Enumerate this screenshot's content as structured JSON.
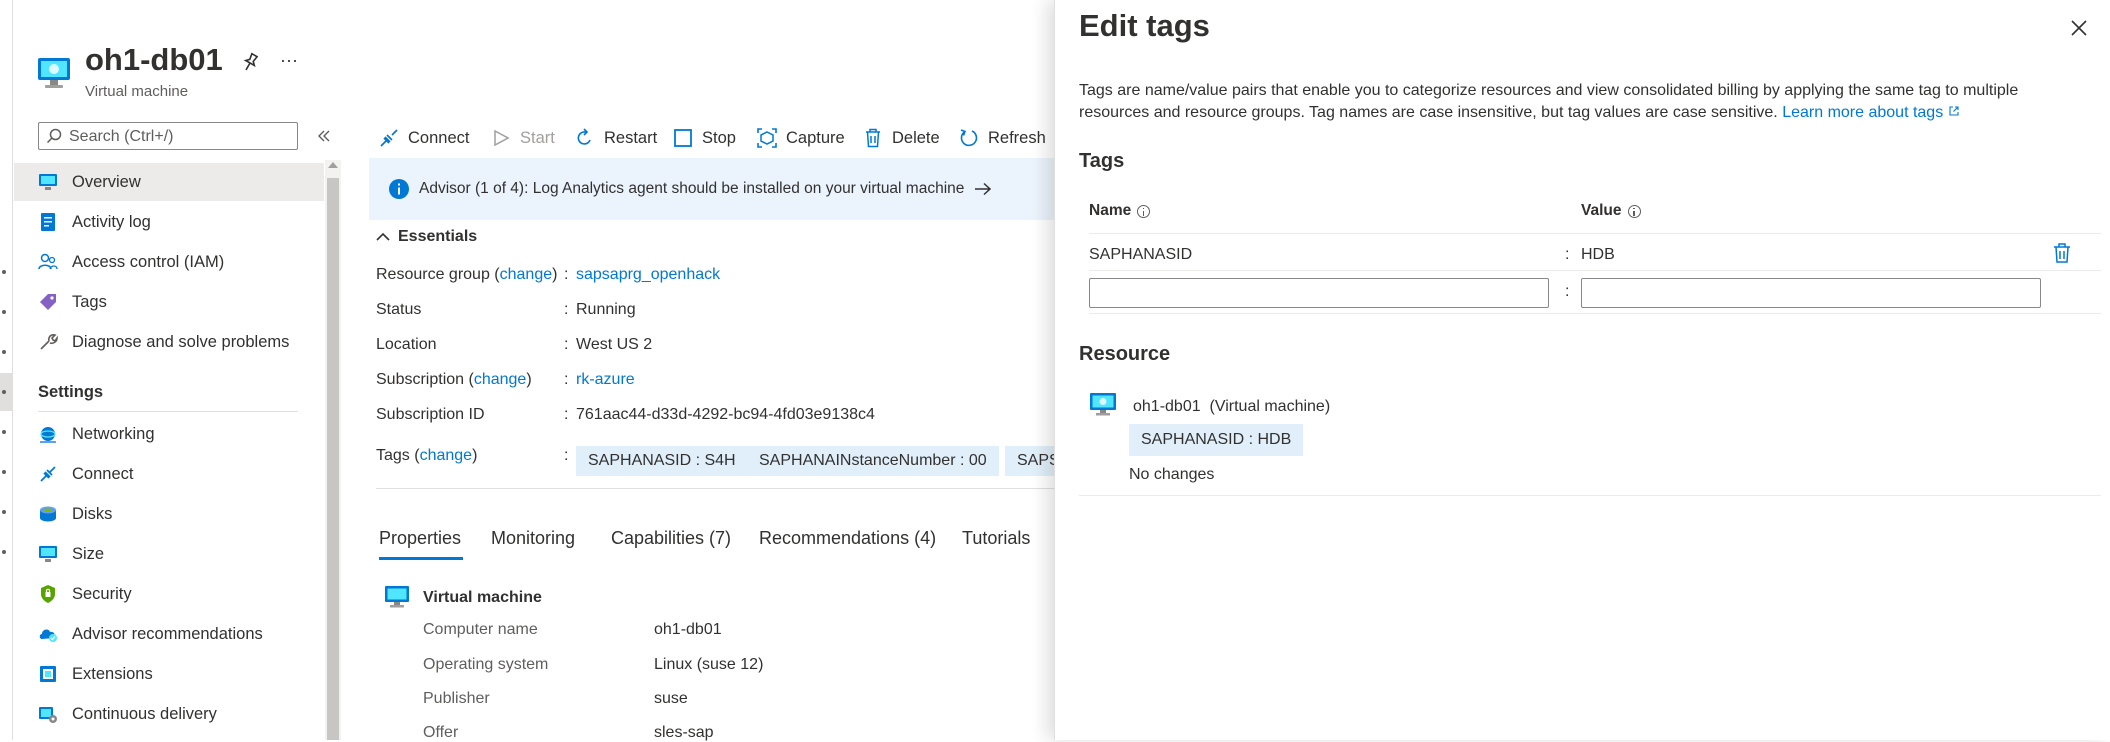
{
  "header": {
    "title": "oh1-db01",
    "subtitle": "Virtual machine",
    "more_label": "···"
  },
  "search": {
    "placeholder": "Search (Ctrl+/)"
  },
  "sidebar": {
    "items": [
      {
        "label": "Overview",
        "icon": "monitor-icon"
      },
      {
        "label": "Activity log",
        "icon": "activity-log-icon"
      },
      {
        "label": "Access control (IAM)",
        "icon": "people-icon"
      },
      {
        "label": "Tags",
        "icon": "tag-icon"
      },
      {
        "label": "Diagnose and solve problems",
        "icon": "wrench-icon"
      }
    ],
    "settings_label": "Settings",
    "settings_items": [
      {
        "label": "Networking",
        "icon": "networking-icon"
      },
      {
        "label": "Connect",
        "icon": "connect-icon"
      },
      {
        "label": "Disks",
        "icon": "disks-icon"
      },
      {
        "label": "Size",
        "icon": "size-icon"
      },
      {
        "label": "Security",
        "icon": "shield-icon"
      },
      {
        "label": "Advisor recommendations",
        "icon": "advisor-icon"
      },
      {
        "label": "Extensions",
        "icon": "extensions-icon"
      },
      {
        "label": "Continuous delivery",
        "icon": "delivery-icon"
      }
    ]
  },
  "toolbar": {
    "connect": "Connect",
    "start": "Start",
    "restart": "Restart",
    "stop": "Stop",
    "capture": "Capture",
    "delete": "Delete",
    "refresh": "Refresh"
  },
  "advisor": {
    "message": "Advisor (1 of 4): Log Analytics agent should be installed on your virtual machine"
  },
  "essentials": {
    "heading": "Essentials",
    "resource_group_label": "Resource group",
    "change": "change",
    "resource_group_value": "sapsaprg_openhack",
    "status_label": "Status",
    "status_value": "Running",
    "location_label": "Location",
    "location_value": "West US 2",
    "subscription_label": "Subscription",
    "subscription_value": "rk-azure",
    "subscription_id_label": "Subscription ID",
    "subscription_id_value": "761aac44-d33d-4292-bc94-4fd03e9138c4",
    "tags_label": "Tags",
    "tags": [
      "SAPHANASID : S4H",
      "SAPHANAINstanceNumber : 00",
      "SAPS"
    ]
  },
  "tabs": [
    "Properties",
    "Monitoring",
    "Capabilities (7)",
    "Recommendations (4)",
    "Tutorials"
  ],
  "properties": {
    "section_title": "Virtual machine",
    "rows": [
      {
        "key": "Computer name",
        "value": "oh1-db01"
      },
      {
        "key": "Operating system",
        "value": "Linux (suse 12)"
      },
      {
        "key": "Publisher",
        "value": "suse"
      },
      {
        "key": "Offer",
        "value": "sles-sap"
      }
    ]
  },
  "panel": {
    "title": "Edit tags",
    "description": "Tags are name/value pairs that enable you to categorize resources and view consolidated billing by applying the same tag to multiple resources and resource groups. Tag names are case insensitive, but tag values are case sensitive.",
    "learn_more": "Learn more about tags",
    "tags_heading": "Tags",
    "name_col": "Name",
    "value_col": "Value",
    "tag_rows": [
      {
        "name": "SAPHANASID",
        "value": "HDB"
      }
    ],
    "new_name_value": "",
    "new_value_value": "",
    "resource_heading": "Resource",
    "resource_name": "oh1-db01",
    "resource_type": "(Virtual machine)",
    "resource_tag": "SAPHANASID : HDB",
    "resource_status": "No changes"
  },
  "colors": {
    "accent": "#0078d4",
    "pill_bg": "#e1effa",
    "banner_bg": "#ebf3fc"
  }
}
